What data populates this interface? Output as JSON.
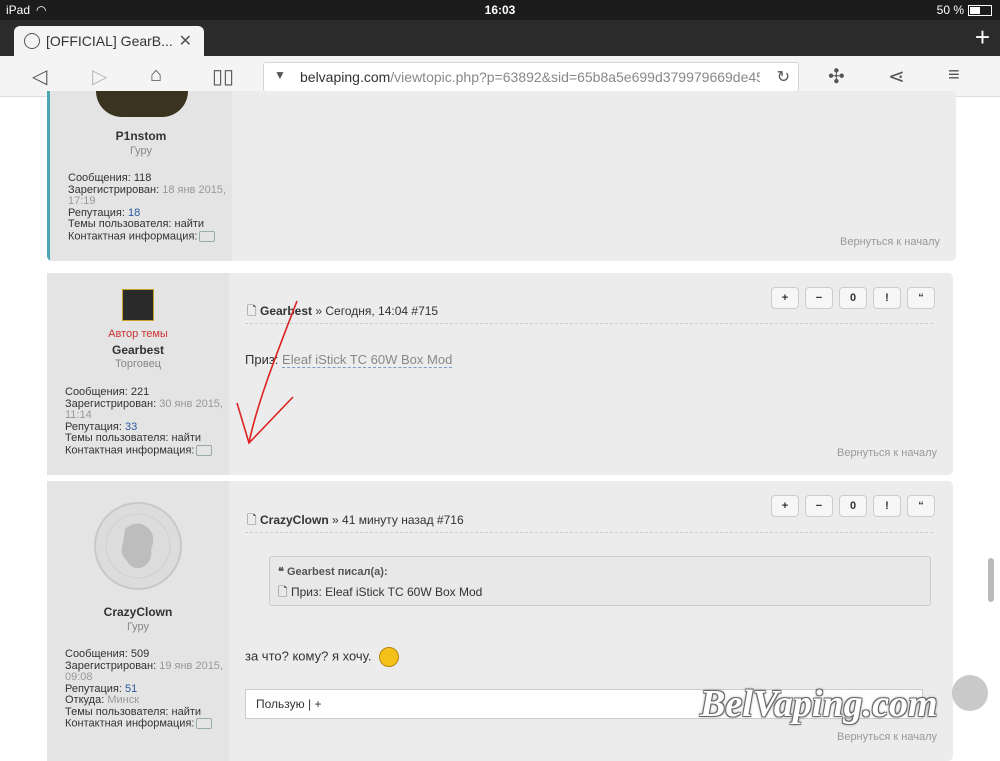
{
  "status": {
    "device": "iPad",
    "time": "16:03",
    "battery": "50 %"
  },
  "tab": {
    "title": "[OFFICIAL] GearB...",
    "close": "✕",
    "new_tab": "+"
  },
  "toolbar": {
    "url_domain": "belvaping.com",
    "url_rest": "/viewtopic.php?p=63892&sid=65b8a5e699d379979669de45"
  },
  "post1": {
    "username": "P1nstom",
    "rank": "Гуру",
    "messages_label": "Сообщения:",
    "messages": "118",
    "registered_label": "Зарегистрирован:",
    "registered": "18 янв 2015, 17:19",
    "reputation_label": "Репутация:",
    "reputation": "18",
    "topics_label": "Темы пользователя:",
    "topics": "найти",
    "contact_label": "Контактная информация:",
    "back_to_top": "Вернуться к началу"
  },
  "post2": {
    "author_tag": "Автор темы",
    "username": "Gearbest",
    "rank": "Торговец",
    "header_user": "Gearbest",
    "header_rest": " » Сегодня, 14:04 #715",
    "body_label": "Приз: ",
    "body_link": "Eleaf iStick TC 60W Box Mod",
    "messages_label": "Сообщения:",
    "messages": "221",
    "registered_label": "Зарегистрирован:",
    "registered": "30 янв 2015, 11:14",
    "reputation_label": "Репутация:",
    "reputation": "33",
    "topics_label": "Темы пользователя:",
    "topics": "найти",
    "contact_label": "Контактная информация:",
    "back_to_top": "Вернуться к началу"
  },
  "post3": {
    "username": "CrazyClown",
    "rank": "Гуру",
    "header_user": "CrazyClown",
    "header_rest": " » 41 минуту назад #716",
    "quote_author": "Gearbest писал(а):",
    "quote_text": "Приз: Eleaf iStick TC 60W Box Mod",
    "body": "за что? кому? я хочу.",
    "reply_text": "Пользую | +",
    "messages_label": "Сообщения:",
    "messages": "509",
    "registered_label": "Зарегистрирован:",
    "registered": "19 янв 2015, 09:08",
    "reputation_label": "Репутация:",
    "reputation": "51",
    "from_label": "Откуда:",
    "from": "Минск",
    "topics_label": "Темы пользователя:",
    "topics": "найти",
    "contact_label": "Контактная информация:",
    "back_to_top": "Вернуться к началу"
  },
  "actions": [
    "+",
    "−",
    "0",
    "!",
    "“"
  ],
  "watermark": "BelVaping.com"
}
